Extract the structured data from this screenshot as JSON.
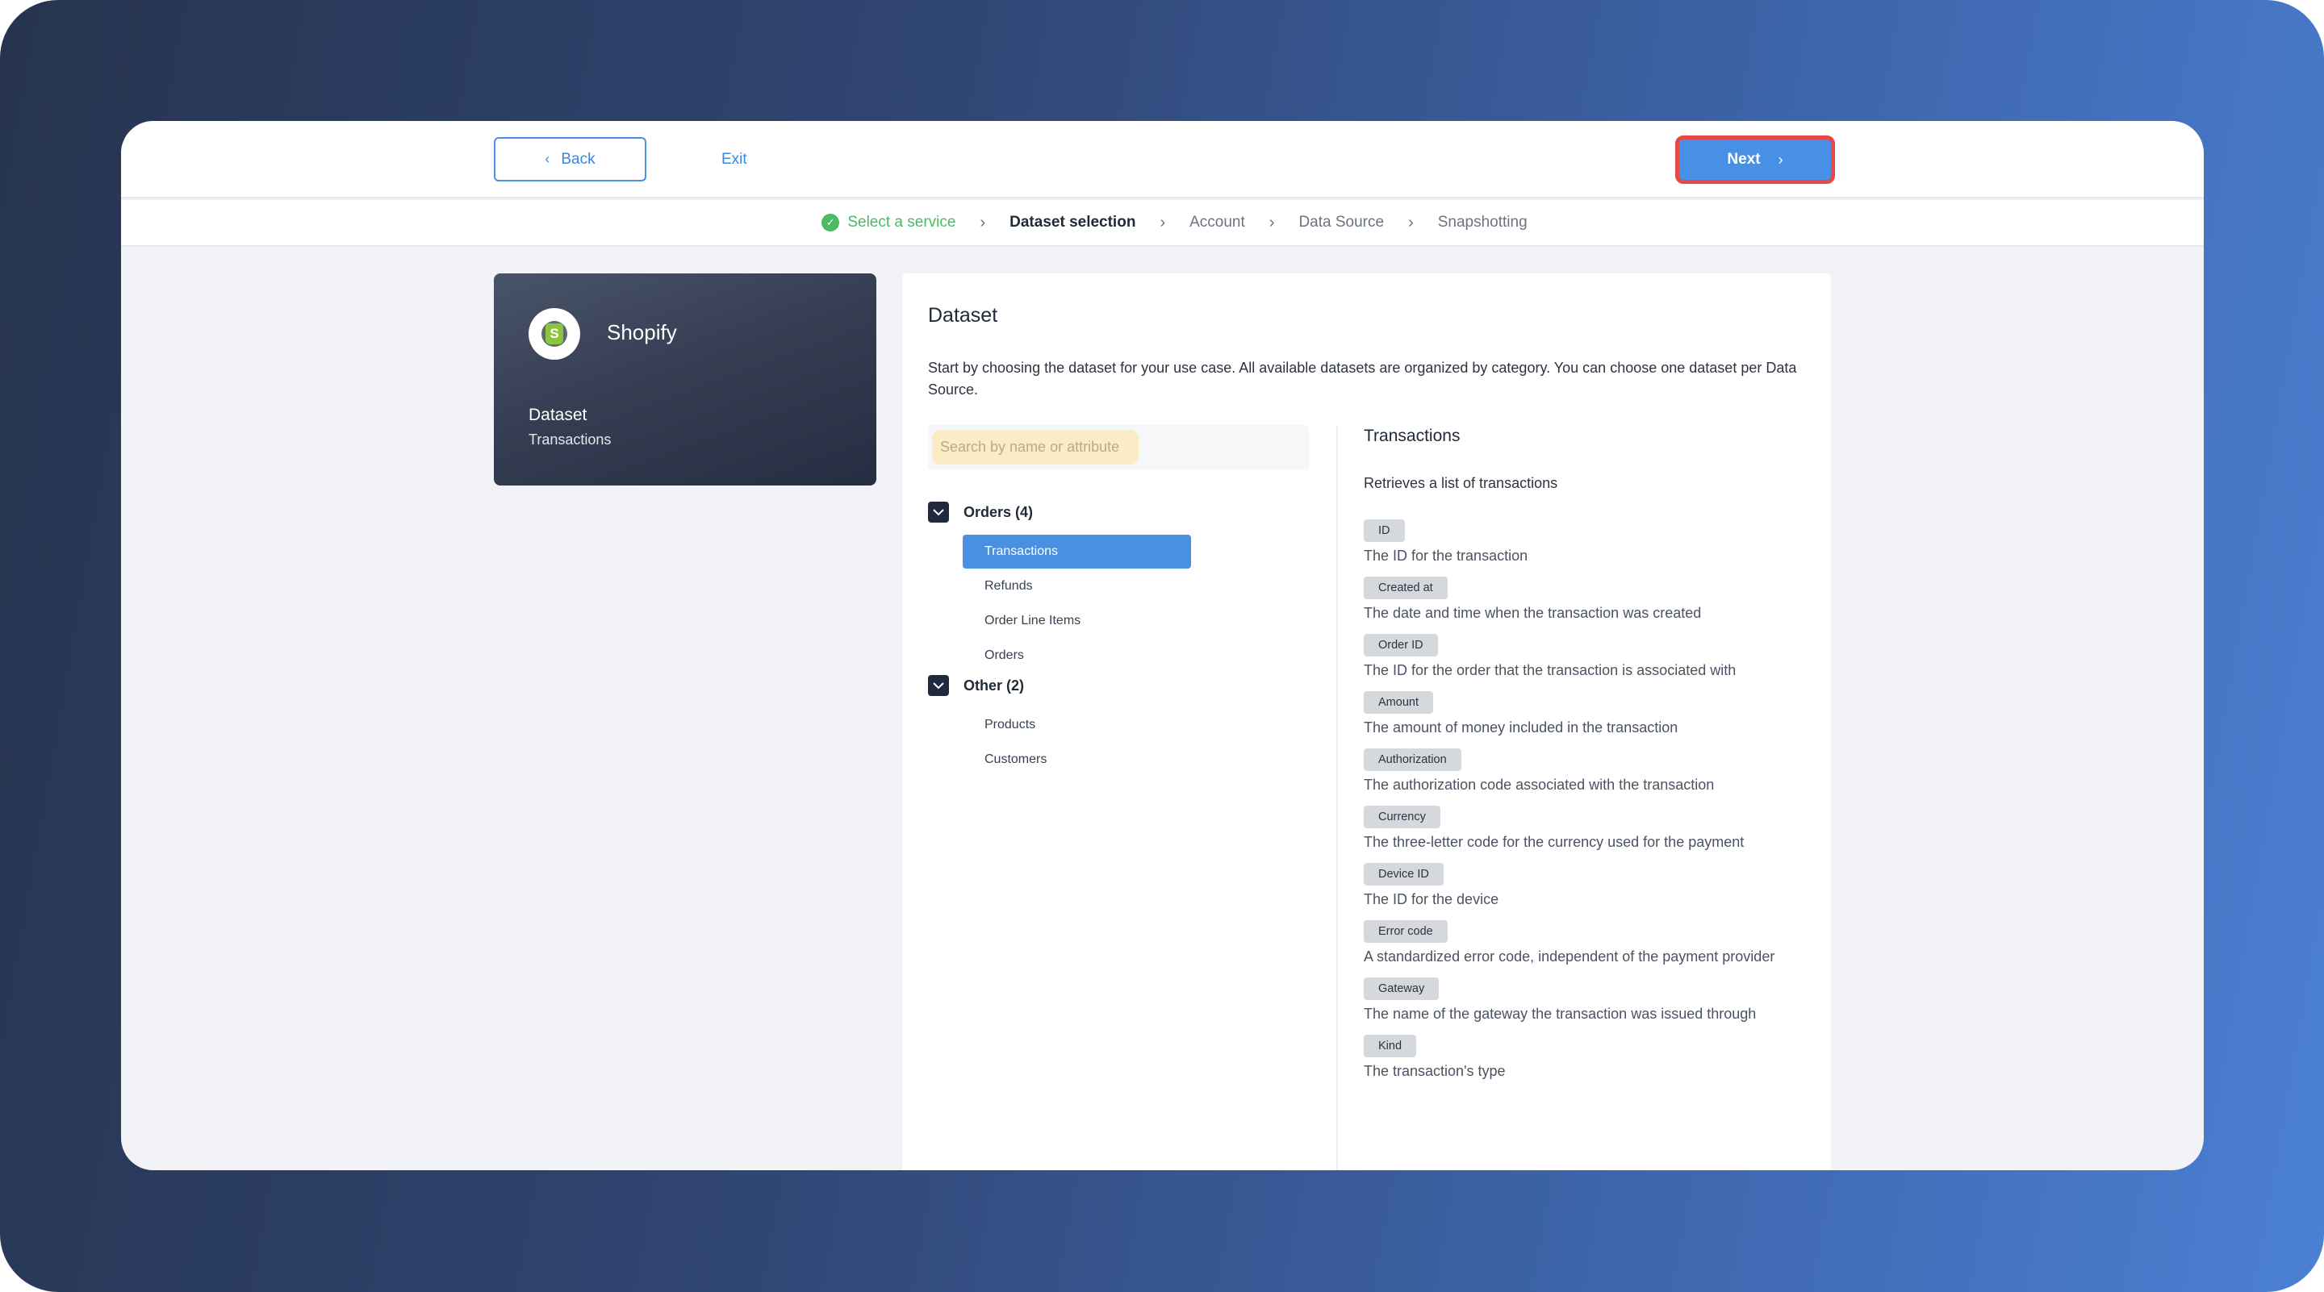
{
  "header": {
    "back_label": "Back",
    "exit_label": "Exit",
    "next_label": "Next"
  },
  "stepper": {
    "steps": [
      {
        "label": "Select a service",
        "state": "done"
      },
      {
        "label": "Dataset selection",
        "state": "current"
      },
      {
        "label": "Account",
        "state": "upcoming"
      },
      {
        "label": "Data Source",
        "state": "upcoming"
      },
      {
        "label": "Snapshotting",
        "state": "upcoming"
      }
    ]
  },
  "service_card": {
    "name": "Shopify",
    "logo_letter": "S",
    "dataset_label": "Dataset",
    "dataset_value": "Transactions"
  },
  "panel": {
    "title": "Dataset",
    "description": "Start by choosing the dataset for your use case. All available datasets are organized by category. You can choose one dataset per Data Source.",
    "search": {
      "placeholder": "Search by name or attribute",
      "value": ""
    },
    "groups": [
      {
        "label": "Orders (4)",
        "expanded": true,
        "items": [
          {
            "label": "Transactions",
            "selected": true
          },
          {
            "label": "Refunds",
            "selected": false
          },
          {
            "label": "Order Line Items",
            "selected": false
          },
          {
            "label": "Orders",
            "selected": false
          }
        ]
      },
      {
        "label": "Other (2)",
        "expanded": true,
        "items": [
          {
            "label": "Products",
            "selected": false
          },
          {
            "label": "Customers",
            "selected": false
          }
        ]
      }
    ],
    "detail": {
      "title": "Transactions",
      "subtitle": "Retrieves a list of transactions",
      "attributes": [
        {
          "name": "ID",
          "description": "The ID for the transaction"
        },
        {
          "name": "Created at",
          "description": "The date and time when the transaction was created"
        },
        {
          "name": "Order ID",
          "description": "The ID for the order that the transaction is associated with"
        },
        {
          "name": "Amount",
          "description": "The amount of money included in the transaction"
        },
        {
          "name": "Authorization",
          "description": "The authorization code associated with the transaction"
        },
        {
          "name": "Currency",
          "description": "The three-letter code for the currency used for the payment"
        },
        {
          "name": "Device ID",
          "description": "The ID for the device"
        },
        {
          "name": "Error code",
          "description": "A standardized error code, independent of the payment provider"
        },
        {
          "name": "Gateway",
          "description": "The name of the gateway the transaction was issued through"
        },
        {
          "name": "Kind",
          "description": "The transaction's type"
        }
      ]
    }
  },
  "colors": {
    "accent": "#4a90e2",
    "success": "#4cb963",
    "highlight_border": "#e8474a",
    "card_dark": "#2f374b"
  }
}
